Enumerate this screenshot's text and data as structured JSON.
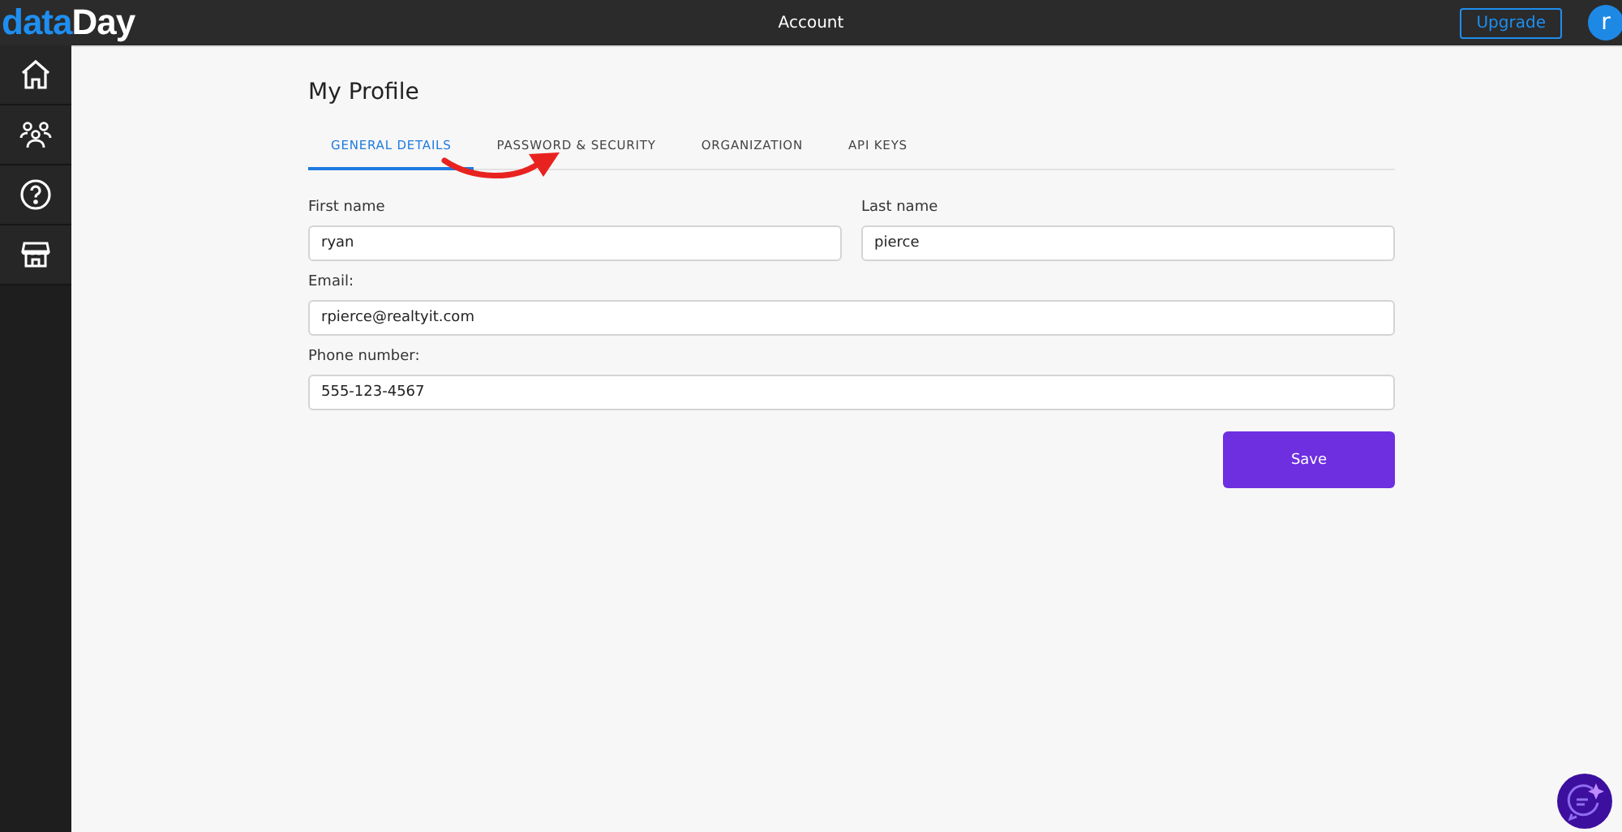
{
  "logo": {
    "accent": "data",
    "rest": "Day"
  },
  "topbar": {
    "title": "Account",
    "upgrade_button": "Upgrade",
    "avatar": "r"
  },
  "sidebar": {
    "items": [
      {
        "kind": "home",
        "selected": false
      },
      {
        "kind": "people",
        "selected": false
      },
      {
        "kind": "help",
        "selected": false
      },
      {
        "kind": "store",
        "selected": false
      }
    ]
  },
  "page": {
    "title": "My Profile",
    "tabs": [
      {
        "label": "GENERAL DETAILS",
        "selected": true
      },
      {
        "label": "PASSWORD & SECURITY",
        "selected": false
      },
      {
        "label": "ORGANIZATION",
        "selected": false
      },
      {
        "label": "API KEYS",
        "selected": false
      }
    ],
    "name_fields": [
      {
        "label": "First name",
        "value": "ryan"
      },
      {
        "label": "Last name",
        "value": "pierce"
      }
    ],
    "fields": [
      {
        "label": "Email:",
        "value": "rpierce@realtyit.com"
      },
      {
        "label": "Phone number:",
        "value": "555-123-4567"
      }
    ],
    "save_button": "Save"
  }
}
